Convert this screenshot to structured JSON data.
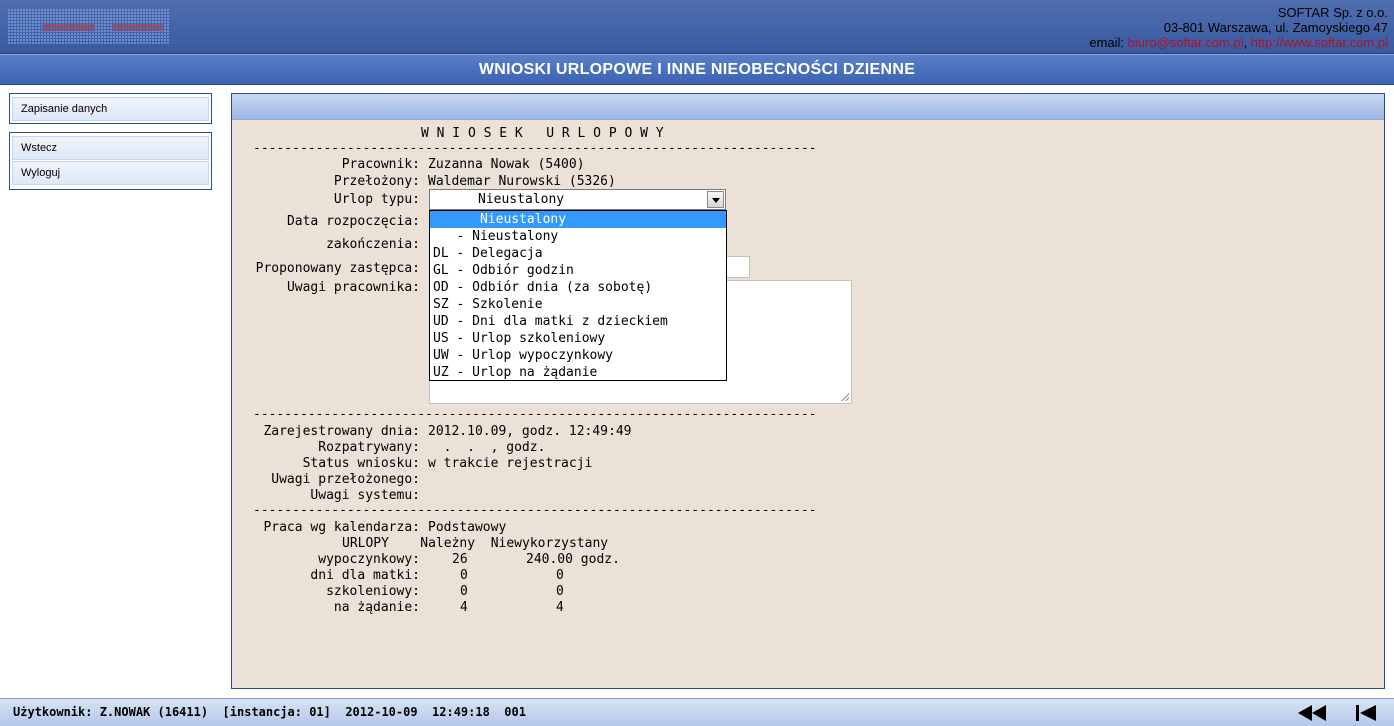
{
  "header": {
    "company_name": "SOFTAR Sp. z o.o.",
    "address": "03-801 Warszawa, ul. Zamoyskiego 47",
    "email_label": "email:",
    "email": "biuro@softar.com.pl",
    "separator": ",",
    "website": "http://www.softar.com.pl"
  },
  "title": "WNIOSKI URLOPOWE I INNE NIEOBECNOŚCI DZIENNE",
  "menu": {
    "group1": [
      "Zapisanie danych"
    ],
    "group2": [
      "Wstecz",
      "Wyloguj"
    ]
  },
  "form": {
    "heading": "W N I O S E K   U R L O P O W Y",
    "separator": "------------------------------------------------------------------------",
    "employee_label": "Pracownik:",
    "employee_value": "Zuzanna Nowak (5400)",
    "supervisor_label": "Przełożony:",
    "supervisor_value": "Waldemar Nurowski (5326)",
    "leave_type_label": "Urlop typu:",
    "leave_type_value": "Nieustalony",
    "start_date_label": "Data rozpoczęcia:",
    "end_date_label": "zakończenia:",
    "substitute_label": "Proponowany zastępca:",
    "employee_notes_label": "Uwagi pracownika:",
    "leave_type_options": [
      "      Nieustalony",
      "   - Nieustalony",
      "DL - Delegacja",
      "GL - Odbiór godzin",
      "OD - Odbiór dnia (za sobotę)",
      "SZ - Szkolenie",
      "UD - Dni dla matki z dzieckiem",
      "US - Urlop szkoleniowy",
      "UW - Urlop wypoczynkowy",
      "UZ - Urlop na żądanie"
    ]
  },
  "registration": {
    "registered_label": "Zarejestrowany dnia:",
    "registered_value": "2012.10.09, godz. 12:49:49",
    "reviewed_label": "Rozpatrywany:",
    "reviewed_value": "  .  .  , godz.",
    "status_label": "Status wniosku:",
    "status_value": "w trakcie rejestracji",
    "supervisor_notes_label": "Uwagi przełożonego:",
    "system_notes_label": "Uwagi systemu:"
  },
  "calendar": {
    "label": "Praca wg kalendarza:",
    "value": "Podstawowy",
    "table_header": "URLOPY    Należny  Niewykorzystany",
    "rows": [
      {
        "label": "wypoczynkowy:",
        "due": "26",
        "unused": "240.00 godz."
      },
      {
        "label": "dni dla matki:",
        "due": "0",
        "unused": "0"
      },
      {
        "label": "szkoleniowy:",
        "due": "0",
        "unused": "0"
      },
      {
        "label": "na żądanie:",
        "due": "4",
        "unused": "4"
      }
    ]
  },
  "status_bar": {
    "text": "Użytkownik: Z.NOWAK (16411)  [instancja: 01]  2012-10-09  12:49:18  001"
  },
  "colors": {
    "header_bg": "#4a6aad",
    "title_bg": "#3a63b3",
    "panel_bg": "#ebe1d7",
    "selected_option": "#3399ff",
    "link": "#b0102a"
  }
}
